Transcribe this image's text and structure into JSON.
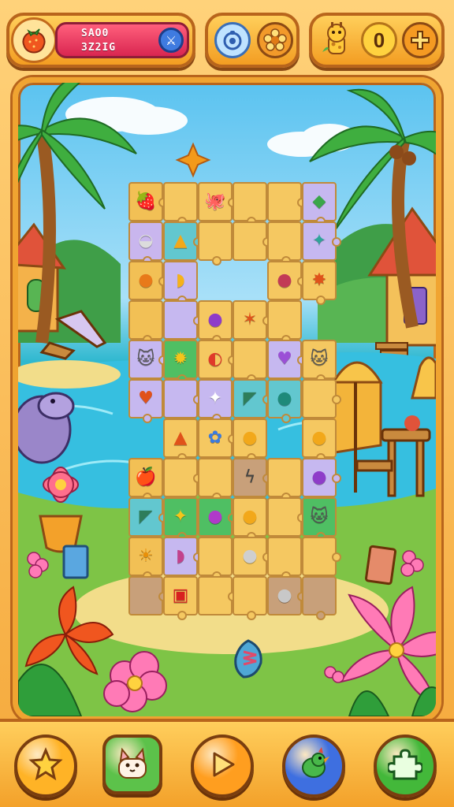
{
  "hud": {
    "score_line1": "SAO0",
    "score_line2": "3Z2IG",
    "counter_value": "0",
    "fruit_icon": "strawberry-icon",
    "score_button_icon": "swords-icon",
    "settings_icon": "gear-flower-icon",
    "bubble_icon": "bubble-icon",
    "pet_icon": "giraffe-icon",
    "plus_icon": "plus-icon"
  },
  "board": {
    "tiles": [
      {
        "r": 0,
        "c": 0,
        "bg": "#f2c055",
        "sym": "🍓",
        "color": "#e0312a"
      },
      {
        "r": 0,
        "c": 1,
        "bg": "#f5c861",
        "sym": "",
        "color": ""
      },
      {
        "r": 0,
        "c": 2,
        "bg": "#f5c861",
        "sym": "🐙",
        "color": "#9b4fd6"
      },
      {
        "r": 0,
        "c": 3,
        "bg": "#f5c861",
        "sym": "",
        "color": ""
      },
      {
        "r": 0,
        "c": 4,
        "bg": "#f5c861",
        "sym": "",
        "color": ""
      },
      {
        "r": 0,
        "c": 5,
        "bg": "#c6b8f0",
        "sym": "◆",
        "color": "#3aa64a"
      },
      {
        "r": 1,
        "c": 0,
        "bg": "#c9b6ee",
        "sym": "◒",
        "color": "#dcdcdc"
      },
      {
        "r": 1,
        "c": 1,
        "bg": "#62c7cf",
        "sym": "▲",
        "color": "#f2a81a"
      },
      {
        "r": 1,
        "c": 2,
        "bg": "#f5c861",
        "sym": "",
        "color": ""
      },
      {
        "r": 1,
        "c": 3,
        "bg": "#f5c861",
        "sym": "",
        "color": ""
      },
      {
        "r": 1,
        "c": 4,
        "bg": "#f5c861",
        "sym": "",
        "color": ""
      },
      {
        "r": 1,
        "c": 5,
        "bg": "#c6b8f0",
        "sym": "✦",
        "color": "#2fa49a"
      },
      {
        "r": 2,
        "c": 0,
        "bg": "#f2c055",
        "sym": "●",
        "color": "#e87a1a"
      },
      {
        "r": 2,
        "c": 1,
        "bg": "#c6b8f0",
        "sym": "◗",
        "color": "#f5b21a"
      },
      {
        "r": 2,
        "c": 4,
        "bg": "#f5c861",
        "sym": "●",
        "color": "#c23a56"
      },
      {
        "r": 2,
        "c": 5,
        "bg": "#f5c861",
        "sym": "✸",
        "color": "#e0521a"
      },
      {
        "r": 3,
        "c": 0,
        "bg": "#f2c055",
        "sym": "",
        "color": ""
      },
      {
        "r": 3,
        "c": 1,
        "bg": "#c6b8f0",
        "sym": "",
        "color": ""
      },
      {
        "r": 3,
        "c": 2,
        "bg": "#f5c861",
        "sym": "●",
        "color": "#8e3cc9"
      },
      {
        "r": 3,
        "c": 3,
        "bg": "#f5c861",
        "sym": "✶",
        "color": "#e0521a"
      },
      {
        "r": 3,
        "c": 4,
        "bg": "#f5c861",
        "sym": "",
        "color": ""
      },
      {
        "r": 4,
        "c": 0,
        "bg": "#c6b8f0",
        "sym": "🐱",
        "color": "#555"
      },
      {
        "r": 4,
        "c": 1,
        "bg": "#4fbf63",
        "sym": "✹",
        "color": "#f5c51a"
      },
      {
        "r": 4,
        "c": 2,
        "bg": "#f5c861",
        "sym": "◐",
        "color": "#e03a2a"
      },
      {
        "r": 4,
        "c": 3,
        "bg": "#f5c861",
        "sym": "",
        "color": ""
      },
      {
        "r": 4,
        "c": 4,
        "bg": "#c6b8f0",
        "sym": "♥",
        "color": "#9b4fd6"
      },
      {
        "r": 4,
        "c": 5,
        "bg": "#f5c861",
        "sym": "🐱",
        "color": "#555"
      },
      {
        "r": 5,
        "c": 0,
        "bg": "#c6b8f0",
        "sym": "♥",
        "color": "#e0521a"
      },
      {
        "r": 5,
        "c": 1,
        "bg": "#c6b8f0",
        "sym": "",
        "color": ""
      },
      {
        "r": 5,
        "c": 2,
        "bg": "#c6b8f0",
        "sym": "✦",
        "color": "#ffffff"
      },
      {
        "r": 5,
        "c": 3,
        "bg": "#62c7cf",
        "sym": "◤",
        "color": "#2e7d5a"
      },
      {
        "r": 5,
        "c": 4,
        "bg": "#62c7cf",
        "sym": "●",
        "color": "#1e8a7a"
      },
      {
        "r": 5,
        "c": 5,
        "bg": "#f5c861",
        "sym": "",
        "color": ""
      },
      {
        "r": 6,
        "c": 1,
        "bg": "#f5c861",
        "sym": "▲",
        "color": "#e0521a"
      },
      {
        "r": 6,
        "c": 2,
        "bg": "#f5c861",
        "sym": "✿",
        "color": "#3a7be0"
      },
      {
        "r": 6,
        "c": 3,
        "bg": "#f5c861",
        "sym": "●",
        "color": "#f2a81a"
      },
      {
        "r": 6,
        "c": 5,
        "bg": "#f5c861",
        "sym": "●",
        "color": "#f2a81a"
      },
      {
        "r": 7,
        "c": 0,
        "bg": "#f2c055",
        "sym": "🍎",
        "color": "#e0312a"
      },
      {
        "r": 7,
        "c": 1,
        "bg": "#f5c861",
        "sym": "",
        "color": ""
      },
      {
        "r": 7,
        "c": 2,
        "bg": "#f5c861",
        "sym": "",
        "color": ""
      },
      {
        "r": 7,
        "c": 3,
        "bg": "#c8a07a",
        "sym": "ϟ",
        "color": "#444"
      },
      {
        "r": 7,
        "c": 4,
        "bg": "#f5c861",
        "sym": "",
        "color": ""
      },
      {
        "r": 7,
        "c": 5,
        "bg": "#c6b8f0",
        "sym": "●",
        "color": "#8e3cc9"
      },
      {
        "r": 8,
        "c": 0,
        "bg": "#62c7cf",
        "sym": "◤",
        "color": "#2e7d5a"
      },
      {
        "r": 8,
        "c": 1,
        "bg": "#4fbf63",
        "sym": "✦",
        "color": "#f5c51a"
      },
      {
        "r": 8,
        "c": 2,
        "bg": "#4fbf63",
        "sym": "●",
        "color": "#b03ac9"
      },
      {
        "r": 8,
        "c": 3,
        "bg": "#f5c861",
        "sym": "●",
        "color": "#f2a81a"
      },
      {
        "r": 8,
        "c": 4,
        "bg": "#f5c861",
        "sym": "",
        "color": ""
      },
      {
        "r": 8,
        "c": 5,
        "bg": "#4fbf63",
        "sym": "🐱",
        "color": "#555"
      },
      {
        "r": 9,
        "c": 0,
        "bg": "#f2c055",
        "sym": "☀",
        "color": "#e8900a"
      },
      {
        "r": 9,
        "c": 1,
        "bg": "#c6b8f0",
        "sym": "◗",
        "color": "#c2418c"
      },
      {
        "r": 9,
        "c": 2,
        "bg": "#f5c861",
        "sym": "",
        "color": ""
      },
      {
        "r": 9,
        "c": 3,
        "bg": "#f5c861",
        "sym": "●",
        "color": "#cfcfcf"
      },
      {
        "r": 9,
        "c": 4,
        "bg": "#f5c861",
        "sym": "",
        "color": ""
      },
      {
        "r": 9,
        "c": 5,
        "bg": "#f5c861",
        "sym": "",
        "color": ""
      },
      {
        "r": 10,
        "c": 0,
        "bg": "#c8a07a",
        "sym": "",
        "color": ""
      },
      {
        "r": 10,
        "c": 1,
        "bg": "#f5c861",
        "sym": "▣",
        "color": "#d82020"
      },
      {
        "r": 10,
        "c": 2,
        "bg": "#f5c861",
        "sym": "",
        "color": ""
      },
      {
        "r": 10,
        "c": 3,
        "bg": "#f5c861",
        "sym": "",
        "color": ""
      },
      {
        "r": 10,
        "c": 4,
        "bg": "#c8a07a",
        "sym": "●",
        "color": "#c8c8c8"
      },
      {
        "r": 10,
        "c": 5,
        "bg": "#c8a07a",
        "sym": "",
        "color": ""
      }
    ],
    "loose_piece_icon": "fish-piece-icon"
  },
  "bottom_bar": [
    {
      "name": "star-button",
      "icon": "star-icon",
      "bg": "#ffb326"
    },
    {
      "name": "pet-button",
      "icon": "cat-icon",
      "bg": "#5cc24a"
    },
    {
      "name": "play-button",
      "icon": "play-icon",
      "bg": "#ff9e1f"
    },
    {
      "name": "hint-button",
      "icon": "bird-icon",
      "bg": "#3e6fe0"
    },
    {
      "name": "puzzle-button",
      "icon": "puzzle-piece-icon",
      "bg": "#43b83a"
    }
  ]
}
